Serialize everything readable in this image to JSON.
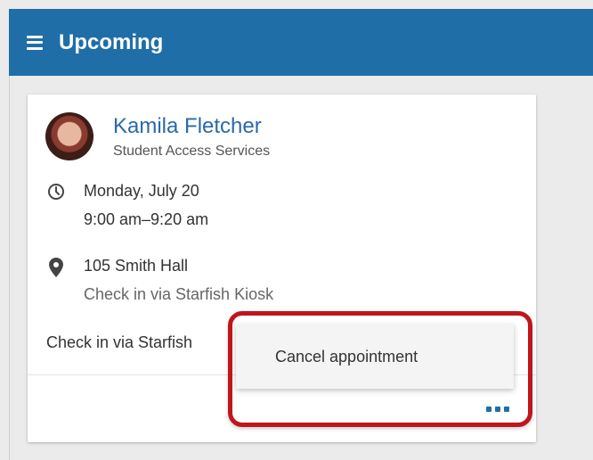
{
  "header": {
    "title": "Upcoming",
    "menu_icon": "hamburger-menu-icon",
    "color": "#1f6ea8"
  },
  "appointment": {
    "person_name": "Kamila Fletcher",
    "department": "Student Access Services",
    "date": "Monday, July 20",
    "time": "9:00 am–9:20 am",
    "location": "105 Smith Hall",
    "location_note": "Check in via Starfish Kiosk",
    "checkin_note": "Check in via Starfish",
    "icons": [
      "clock-icon",
      "map-pin-icon",
      "more-options-icon"
    ]
  },
  "menu": {
    "items": [
      "Cancel appointment"
    ]
  },
  "colors": {
    "accent": "#1f6ea8",
    "link": "#2a6aa8",
    "highlight": "#c0161b"
  }
}
